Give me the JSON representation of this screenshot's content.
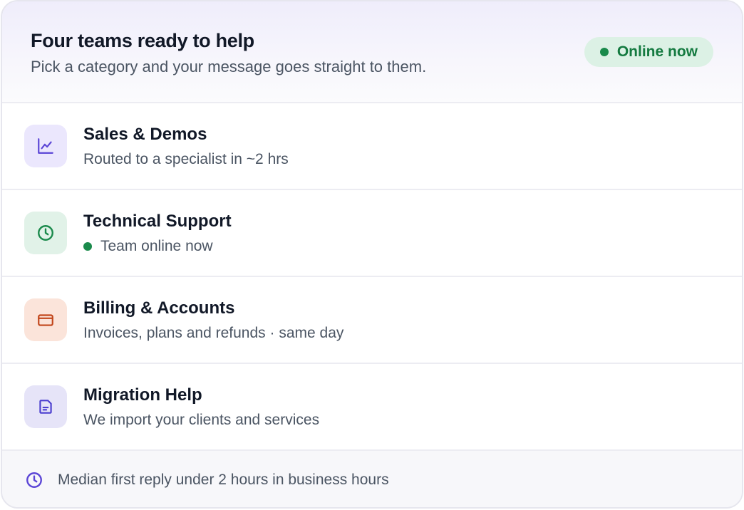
{
  "header": {
    "title": "Four teams ready to help",
    "subtitle": "Pick a category and your message goes straight to them.",
    "status": {
      "label": "Online now",
      "color": "#147a40"
    }
  },
  "categories": [
    {
      "title": "Sales & Demos",
      "subtitle": "Routed to a specialist in ~2 hrs",
      "icon": "chart-line-icon",
      "icon_bg": "#ebe7fd",
      "icon_color": "#5b45d6"
    },
    {
      "title": "Technical Support",
      "subtitle": "Team online now",
      "icon": "clock-icon",
      "icon_bg": "#e1f2e8",
      "icon_color": "#1a8a4b"
    },
    {
      "title": "Billing & Accounts",
      "subtitle": "Invoices, plans and refunds · same day",
      "icon": "credit-card-icon",
      "icon_bg": "#fbe4da",
      "icon_color": "#c2461b"
    },
    {
      "title": "Migration Help",
      "subtitle": "We import your clients and services",
      "icon": "document-icon",
      "icon_bg": "#e6e4f8",
      "icon_color": "#4c3fcf"
    }
  ],
  "footer": {
    "text": "Median first reply under 2 hours in business hours",
    "icon": "clock-icon",
    "icon_color": "#5b45d6"
  }
}
